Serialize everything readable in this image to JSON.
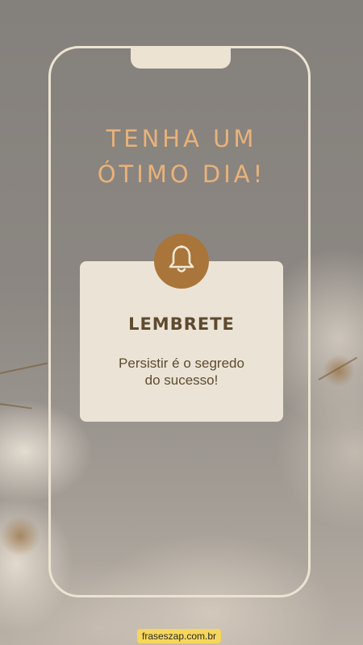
{
  "headline": {
    "line1": "TENHA UM",
    "line2": "ÓTIMO DIA!"
  },
  "reminder": {
    "icon": "bell-icon",
    "title": "LEMBRETE",
    "message_line1": "Persistir é o segredo",
    "message_line2": "do sucesso!"
  },
  "footer": {
    "site": "fraseszap.com.br"
  },
  "colors": {
    "headline": "#e9b27a",
    "accent": "#a9753a",
    "card": "#ebe4d6",
    "frame": "#ece3d2",
    "text": "#5e4a2e",
    "badge": "#f6d65c"
  }
}
